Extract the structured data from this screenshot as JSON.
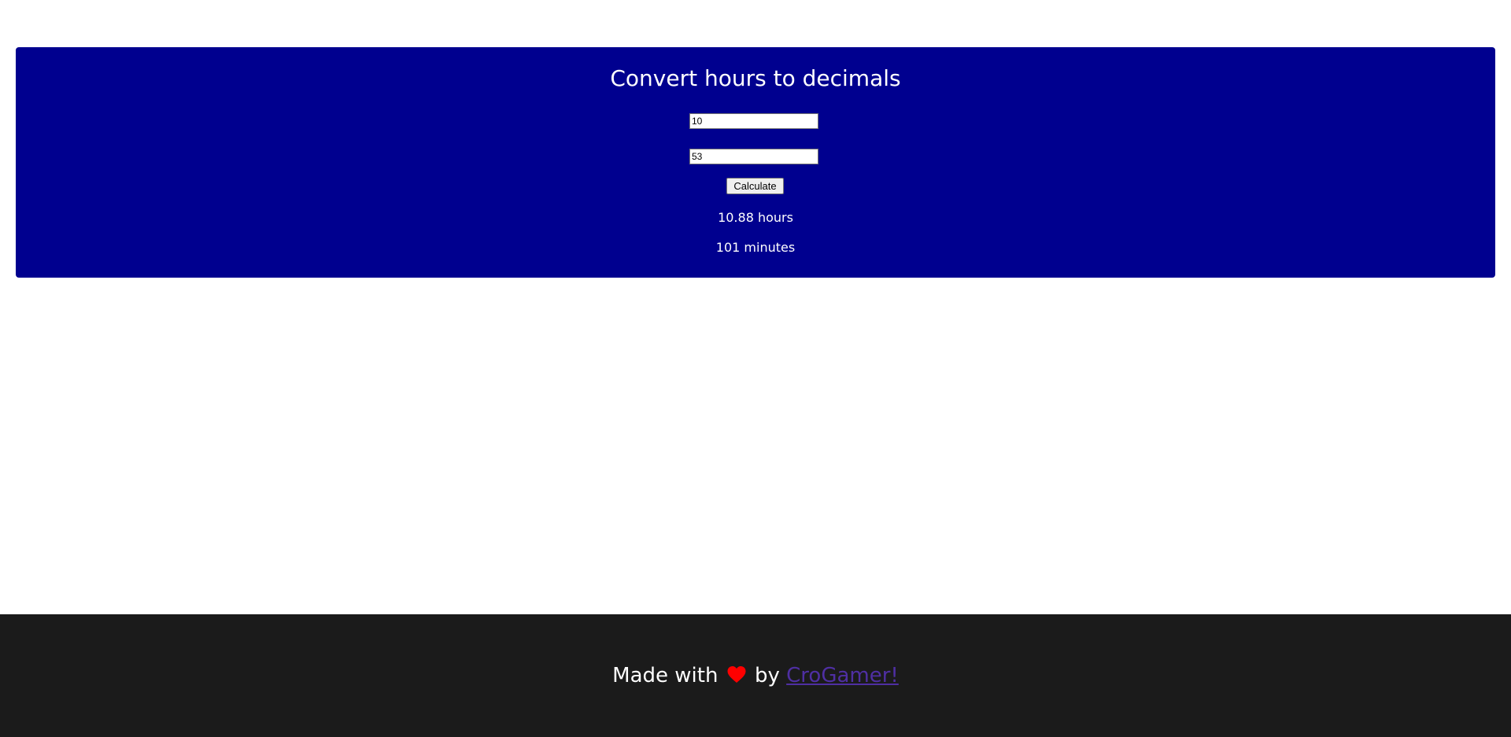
{
  "converter": {
    "title": "Convert hours to decimals",
    "hours_value": "10",
    "minutes_value": "53",
    "calculate_label": "Calculate",
    "result_hours": "10.88 hours",
    "result_minutes": "101 minutes",
    "accent_color": "#00008f"
  },
  "footer": {
    "made_with": "Made with",
    "heart_icon": "heart-icon",
    "by": "by",
    "author_link": "CroGamer!",
    "background_color": "#1b1b1b",
    "heart_color": "#ff0000"
  }
}
